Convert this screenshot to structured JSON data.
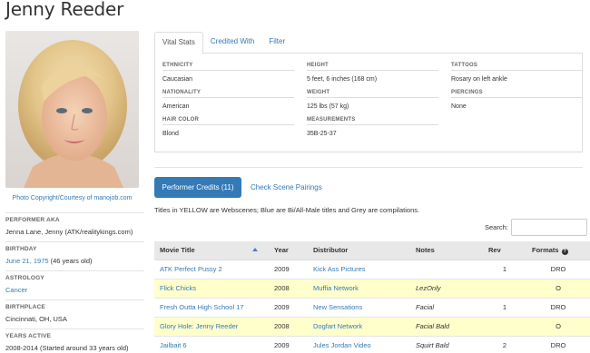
{
  "page_title": "Jenny Reeder",
  "photo_credit": "Photo Copyright/Courtesy of manojob.com",
  "bio": {
    "aka_label": "PERFORMER AKA",
    "aka_value": "Jenna Lane, Jenny (ATK/realitykings.com)",
    "birthday_label": "BIRTHDAY",
    "birthday_link": "June 21, 1975",
    "birthday_age": " (46 years old)",
    "astrology_label": "ASTROLOGY",
    "astrology_value": "Cancer",
    "birthplace_label": "BIRTHPLACE",
    "birthplace_value": "Cincinnati, OH, USA",
    "years_label": "YEARS ACTIVE",
    "years_value": "2008-2014 (Started around 33 years old)"
  },
  "tabs": [
    "Vital Stats",
    "Credited With",
    "Filter"
  ],
  "stats": {
    "ethnicity_label": "ETHNICITY",
    "ethnicity_value": "Caucasian",
    "nationality_label": "NATIONALITY",
    "nationality_value": "American",
    "hair_label": "HAIR COLOR",
    "hair_value": "Blond",
    "height_label": "HEIGHT",
    "height_value": "5 feet, 6 inches (168 cm)",
    "weight_label": "WEIGHT",
    "weight_value": "125 lbs (57 kg)",
    "measurements_label": "MEASUREMENTS",
    "measurements_value": "35B-25-37",
    "tattoos_label": "TATTOOS",
    "tattoos_value": "Rosary on left ankle",
    "piercings_label": "PIERCINGS",
    "piercings_value": "None"
  },
  "credits_button": "Performer Credits (11)",
  "pairings_link": "Check Scene Pairings",
  "legend": "Titles in YELLOW are Webscenes; Blue are Bi/All-Male titles and Grey are compilations.",
  "search_label": "Search:",
  "search_value": "",
  "table": {
    "headers": [
      "Movie Title",
      "Year",
      "Distributor",
      "Notes",
      "Rev",
      "Formats"
    ],
    "rows": [
      {
        "title": "ATK Perfect Pussy 2",
        "year": "2009",
        "distributor": "Kick Ass Pictures",
        "notes": "",
        "rev": "1",
        "formats": "DRO",
        "yellow": false
      },
      {
        "title": "Flick Chicks",
        "year": "2008",
        "distributor": "Muffia Network",
        "notes": "LezOnly",
        "rev": "",
        "formats": "O",
        "yellow": true
      },
      {
        "title": "Fresh Outta High School 17",
        "year": "2009",
        "distributor": "New Sensations",
        "notes": "Facial",
        "rev": "1",
        "formats": "DRO",
        "yellow": false
      },
      {
        "title": "Glory Hole: Jenny Reeder",
        "year": "2008",
        "distributor": "Dogfart Network",
        "notes": "Facial Bald",
        "rev": "",
        "formats": "O",
        "yellow": true
      },
      {
        "title": "Jailbait 6",
        "year": "2009",
        "distributor": "Jules Jordan Video",
        "notes": "Squirt Bald",
        "rev": "2",
        "formats": "DRO",
        "yellow": false
      }
    ]
  },
  "colors": {
    "link": "#337ab7",
    "webscene_row": "#ffffcc",
    "header_bg": "#e8e8e8"
  }
}
